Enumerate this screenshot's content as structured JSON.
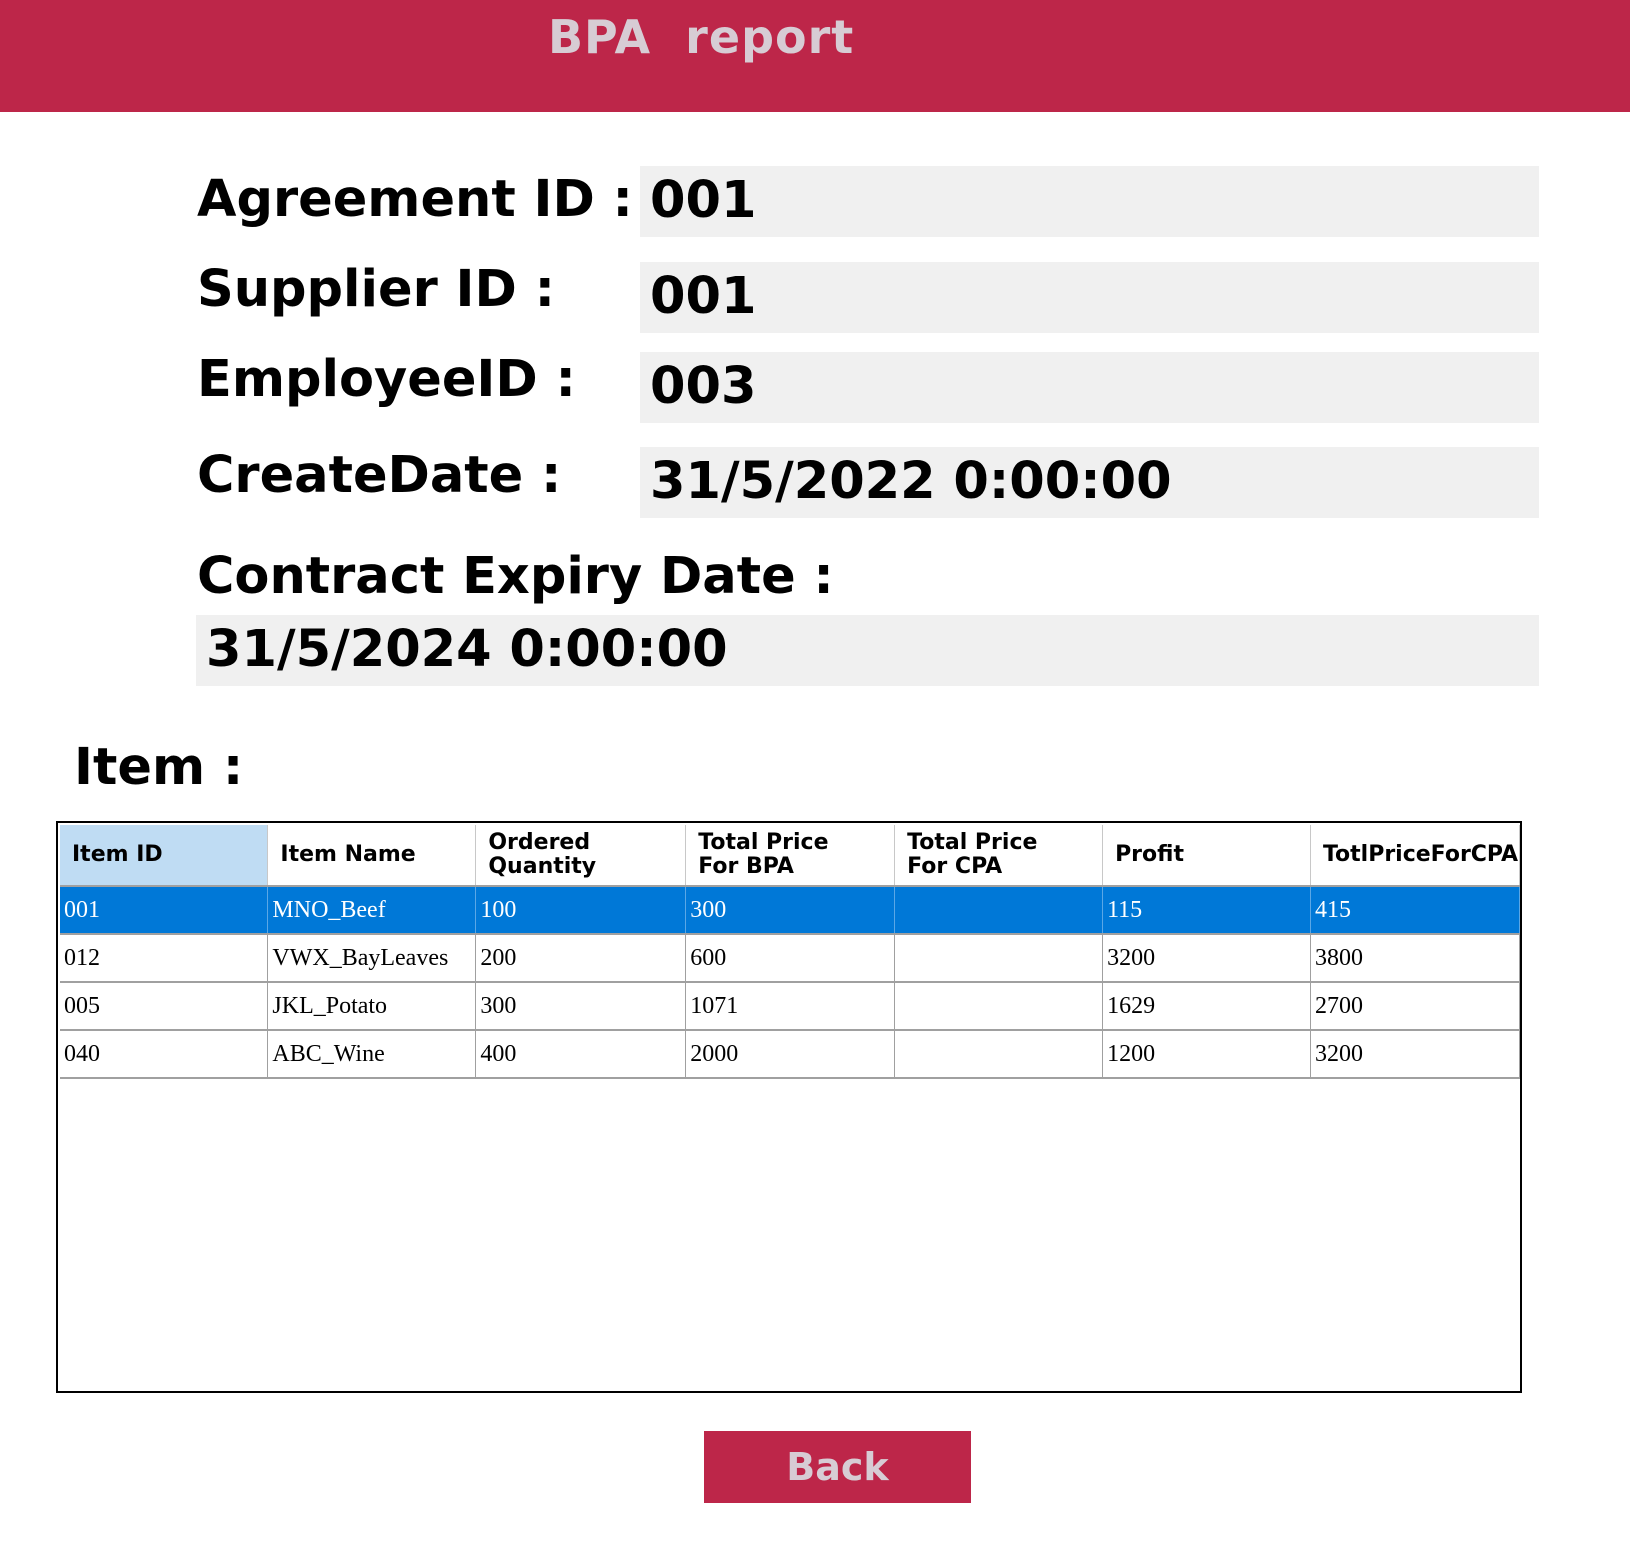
{
  "header": {
    "title": "BPA  report"
  },
  "form": {
    "agreement_id": {
      "label": "Agreement ID :",
      "value": "001"
    },
    "supplier_id": {
      "label": "Supplier ID :",
      "value": "001"
    },
    "employee_id": {
      "label": "EmployeeID :",
      "value": "003"
    },
    "create_date": {
      "label": "CreateDate :",
      "value": "31/5/2022 0:00:00"
    },
    "expiry_date": {
      "label": "Contract Expiry Date :",
      "value": "31/5/2024 0:00:00"
    }
  },
  "items": {
    "label": "Item :",
    "columns": [
      {
        "line1": "Item ID",
        "line2": ""
      },
      {
        "line1": "Item Name",
        "line2": ""
      },
      {
        "line1": "Ordered",
        "line2": "Quantity"
      },
      {
        "line1": "Total Price",
        "line2": "For BPA"
      },
      {
        "line1": "Total Price",
        "line2": "For CPA"
      },
      {
        "line1": "Profit",
        "line2": ""
      },
      {
        "line1": "TotlPriceForCPA",
        "line2": ""
      }
    ],
    "rows": [
      [
        "001",
        "MNO_Beef",
        "100",
        "300",
        "",
        "115",
        "415"
      ],
      [
        "012",
        "VWX_BayLeaves",
        "200",
        "600",
        "",
        "3200",
        "3800"
      ],
      [
        "005",
        "JKL_Potato",
        "300",
        "1071",
        "",
        "1629",
        "2700"
      ],
      [
        "040",
        "ABC_Wine",
        "400",
        "2000",
        "",
        "1200",
        "3200"
      ]
    ],
    "selected_row": 0
  },
  "actions": {
    "back_label": "Back"
  },
  "colors": {
    "accent": "#bd2649",
    "selection": "#0078d7",
    "header_selected": "#bfdcf3",
    "field_bg": "#f0f0f0"
  }
}
